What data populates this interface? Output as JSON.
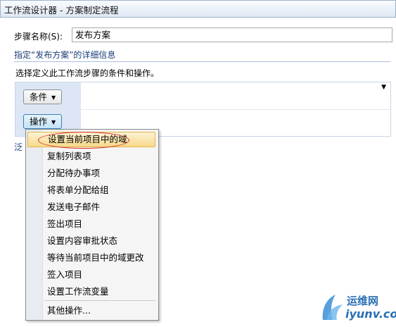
{
  "window": {
    "title": "工作流设计器 - 方案制定流程"
  },
  "step": {
    "label": "步骤名称(S):",
    "value": "发布方案"
  },
  "details": {
    "header": "指定“发布方案”的详细信息",
    "description": "选择定义此工作流步骤的条件和操作。"
  },
  "rules": {
    "conditions_label": "条件",
    "actions_label": "操作",
    "truncated_text": "泛"
  },
  "menu": {
    "items": [
      "设置当前项目中的域",
      "复制列表项",
      "分配待办事项",
      "将表单分配给组",
      "发送电子邮件",
      "签出项目",
      "设置内容审批状态",
      "等待当前项目中的域更改",
      "签入项目",
      "设置工作流变量"
    ],
    "more_label": "其他操作..."
  },
  "watermark": {
    "line1": "运维网",
    "line2": "iyunv.com"
  },
  "colors": {
    "accent": "#1a3d7a",
    "highlight": "#f6d98a",
    "annotation": "#d43030"
  }
}
